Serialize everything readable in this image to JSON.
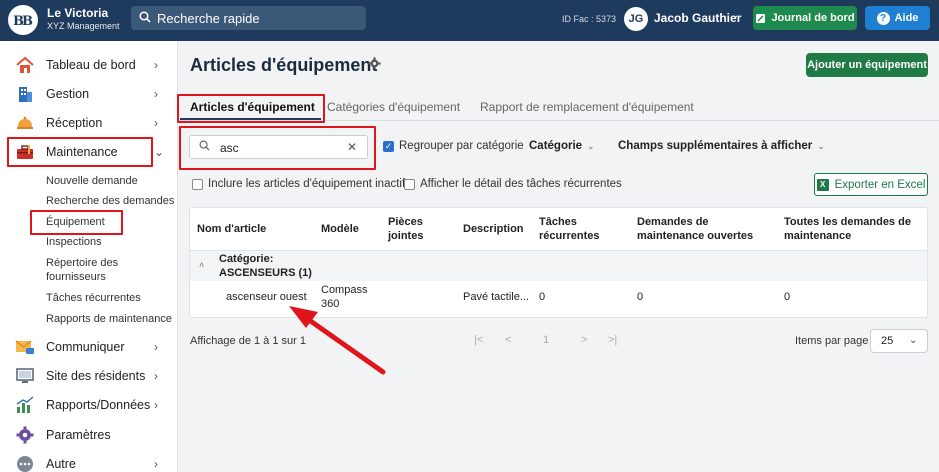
{
  "topbar": {
    "logo_text": "ꟷB",
    "brand_name": "Le Victoria",
    "brand_sub": "XYZ Management",
    "search_placeholder": "Recherche rapide",
    "id_fac": "ID Fac : 5373",
    "avatar_initials": "JG",
    "user_name": "Jacob Gauthier",
    "journal_label": "Journal de bord",
    "aide_label": "Aide",
    "colors": {
      "bar": "#1e3a5c",
      "journal": "#1f8a4d",
      "aide": "#1e7fd3"
    }
  },
  "sidebar": {
    "items": [
      {
        "label": "Tableau de bord",
        "icon": "house-icon"
      },
      {
        "label": "Gestion",
        "icon": "building-icon"
      },
      {
        "label": "Réception",
        "icon": "bell-icon"
      },
      {
        "label": "Maintenance",
        "icon": "toolbox-icon",
        "expanded": true
      },
      {
        "label": "Communiquer",
        "icon": "envelope-icon"
      },
      {
        "label": "Site des résidents",
        "icon": "monitor-icon"
      },
      {
        "label": "Rapports/Données",
        "icon": "bar-chart-icon"
      },
      {
        "label": "Paramètres",
        "icon": "gear-icon"
      },
      {
        "label": "Autre",
        "icon": "more-icon"
      }
    ],
    "maintenance_sub": [
      "Nouvelle demande",
      "Recherche des demandes",
      "Équipement",
      "Inspections",
      "Répertoire des",
      "fournisseurs",
      "Tâches récurrentes",
      "Rapports de maintenance"
    ]
  },
  "main": {
    "title": "Articles d'équipement",
    "add_button": "Ajouter un équipement",
    "tabs": [
      "Articles d'équipement",
      "Catégories d'équipement",
      "Rapport de remplacement d'équipement"
    ],
    "search_value": "asc",
    "group_by_label": "Regrouper par catégorie",
    "category_dropdown": "Catégorie",
    "extra_fields_dropdown": "Champs supplémentaires à afficher",
    "include_inactive_label": "Inclure les articles d'équipement inactifs",
    "show_recurring_label": "Afficher le détail des tâches récurrentes",
    "export_label": "Exporter en Excel"
  },
  "table": {
    "headers": [
      "Nom d'article",
      "Modèle",
      "Pièces jointes",
      "Description",
      "Tâches récurrentes",
      "Demandes de maintenance ouvertes",
      "Toutes les demandes de maintenance"
    ],
    "group_line1": "Catégorie:",
    "group_line2": "ASCENSEURS (1)",
    "rows": [
      {
        "name": "ascenseur ouest",
        "model_line1": "Compass",
        "model_line2": "360",
        "attachments": "",
        "description": "Pavé tactile...",
        "recurring": "0",
        "open_requests": "0",
        "all_requests": "0"
      }
    ]
  },
  "pagination": {
    "info": "Affichage de 1 à 1 sur 1",
    "first": "|<",
    "prev": "<",
    "page": "1",
    "next": ">",
    "last": ">|",
    "items_per_page_label": "Items par page",
    "items_per_page": "25"
  }
}
